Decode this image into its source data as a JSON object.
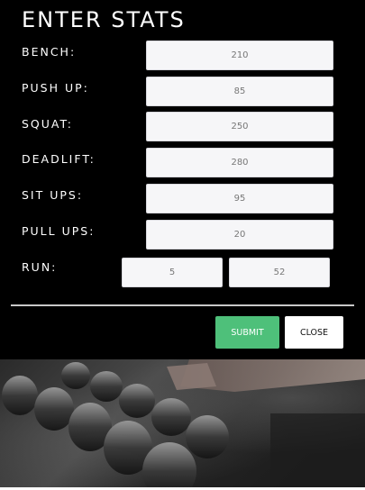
{
  "modal": {
    "title": "ENTER STATS",
    "fields": [
      {
        "label": "BENCH:",
        "value": "210"
      },
      {
        "label": "PUSH UP:",
        "value": "85"
      },
      {
        "label": "SQUAT:",
        "value": "250"
      },
      {
        "label": "DEADLIFT:",
        "value": "280"
      },
      {
        "label": "SIT UPS:",
        "value": "95"
      },
      {
        "label": "PULL UPS:",
        "value": "20"
      }
    ],
    "run": {
      "label": "RUN:",
      "minutes": "5",
      "seconds": "52"
    },
    "buttons": {
      "submit": "SUBMIT",
      "close": "CLOSE"
    }
  },
  "colors": {
    "modal_bg": "#000000",
    "submit_bg": "#4ec07a",
    "field_bg": "#f6f6f8"
  }
}
